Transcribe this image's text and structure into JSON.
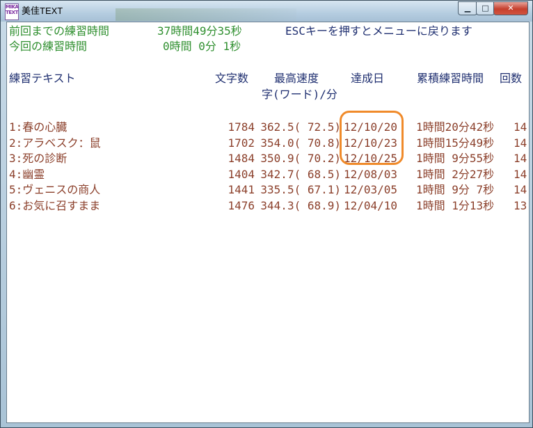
{
  "window": {
    "title": "美佳TEXT",
    "app_icon_lines": [
      "MIKA",
      "TEXT"
    ]
  },
  "header": {
    "prev_label": "前回までの練習時間",
    "prev_value": "37時間49分35秒",
    "esc_message": "ESCキーを押すとメニューに戻ります",
    "curr_label": "今回の練習時間",
    "curr_value": "0時間 0分 1秒"
  },
  "columns": {
    "text": "練習テキスト",
    "chars": "文字数",
    "speed": "最高速度",
    "speed_unit": "字(ワード)/分",
    "date": "達成日",
    "total": "累積練習時間",
    "count": "回数"
  },
  "rows": [
    {
      "name": "1:春の心臓",
      "chars": "1784",
      "speed": "362.5( 72.5)",
      "date": "12/10/20",
      "total": "1時間20分42秒",
      "count": "14"
    },
    {
      "name": "2:アラベスク：鼠",
      "chars": "1702",
      "speed": "354.0( 70.8)",
      "date": "12/10/23",
      "total": "1時間15分49秒",
      "count": "14"
    },
    {
      "name": "3:死の診断",
      "chars": "1484",
      "speed": "350.9( 70.2)",
      "date": "12/10/25",
      "total": "1時間 9分55秒",
      "count": "14"
    },
    {
      "name": "4:幽霊",
      "chars": "1404",
      "speed": "342.7( 68.5)",
      "date": "12/08/03",
      "total": "1時間 2分27秒",
      "count": "14"
    },
    {
      "name": "5:ヴェニスの商人",
      "chars": "1441",
      "speed": "335.5( 67.1)",
      "date": "12/03/05",
      "total": "1時間 9分 7秒",
      "count": "14"
    },
    {
      "name": "6:お気に召すまま",
      "chars": "1476",
      "speed": "344.3( 68.9)",
      "date": "12/04/10",
      "total": "1時間 1分13秒",
      "count": "13"
    }
  ],
  "colors": {
    "header_green": "#2f8f2f",
    "column_navy": "#1f2f70",
    "row_brown": "#8b3f2a",
    "highlight_orange": "#f08a2a"
  }
}
